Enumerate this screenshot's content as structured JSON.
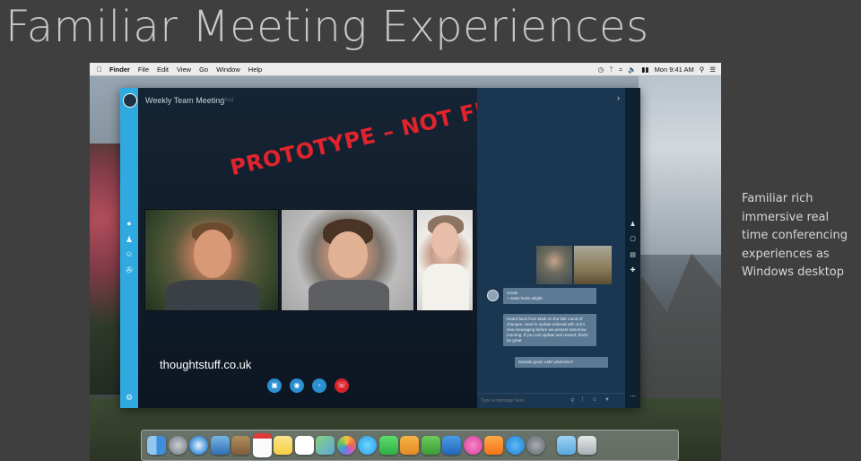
{
  "slide": {
    "title": "Familiar Meeting Experiences",
    "side_note": "Familiar rich immersive real time conferencing experiences as Windows desktop"
  },
  "menubar": {
    "items": [
      "Finder",
      "File",
      "Edit",
      "View",
      "Go",
      "Window",
      "Help"
    ],
    "clock": "Mon 9:41 AM"
  },
  "app": {
    "meeting_title": "Weekly Team Meeting",
    "meeting_subtitle": "Host",
    "overlay": "PROTOTYPE – NOT FINAL",
    "watermark": "thoughtstuff.co.uk",
    "chat": {
      "messages": [
        "Great!\n+ news looks alright",
        "Heard back from Mark on the last round of changes, need to update editorial with Jon's new messaging before we present tomorrow morning. If you can update and resend, that'd be great",
        "Sounds good, LMK what time?"
      ],
      "input_placeholder": "Type a message here"
    }
  },
  "colors": {
    "sidebar": "#2fa9e0",
    "hangup": "#d8232d",
    "control": "#2b8fd1",
    "overlay": "#e0232c",
    "chat_panel": "#1a3650"
  },
  "dock": {
    "icons": [
      "finder",
      "launchpad",
      "safari",
      "mail",
      "contacts",
      "calendar",
      "notes",
      "reminders",
      "maps",
      "photos",
      "messages",
      "facetime",
      "pages",
      "numbers",
      "keynote",
      "itunes",
      "ibooks",
      "app-store",
      "system-preferences",
      "downloads",
      "trash"
    ]
  }
}
